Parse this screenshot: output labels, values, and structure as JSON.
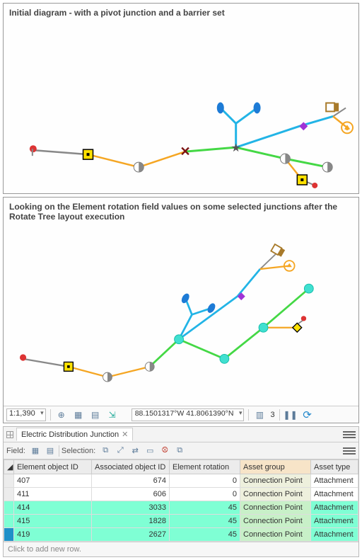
{
  "panel1": {
    "title": "Initial diagram - with a pivot junction and a barrier set"
  },
  "panel2": {
    "title": "Looking on the Element rotation field values on some selected junctions after the Rotate Tree layout execution"
  },
  "status": {
    "scale": "1:1,390",
    "coords": "88.1501317°W 41.8061390°N",
    "sel_count": "3"
  },
  "table": {
    "tab_label": "Electric Distribution Junction",
    "field_label": "Field:",
    "selection_label": "Selection:",
    "placeholder": "Click to add new row.",
    "columns": [
      "Element object ID",
      "Associated object ID",
      "Element rotation",
      "Asset group",
      "Asset type"
    ],
    "rows": [
      {
        "eid": "407",
        "aid": "674",
        "rot": "0",
        "group": "Connection Point",
        "type": "Attachment",
        "sel": false,
        "cur": false
      },
      {
        "eid": "411",
        "aid": "606",
        "rot": "0",
        "group": "Connection Point",
        "type": "Attachment",
        "sel": false,
        "cur": false
      },
      {
        "eid": "414",
        "aid": "3033",
        "rot": "45",
        "group": "Connection Point",
        "type": "Attachment",
        "sel": true,
        "cur": false
      },
      {
        "eid": "415",
        "aid": "1828",
        "rot": "45",
        "group": "Connection Point",
        "type": "Attachment",
        "sel": true,
        "cur": false
      },
      {
        "eid": "419",
        "aid": "2627",
        "rot": "45",
        "group": "Connection Point",
        "type": "Attachment",
        "sel": true,
        "cur": true
      }
    ]
  }
}
